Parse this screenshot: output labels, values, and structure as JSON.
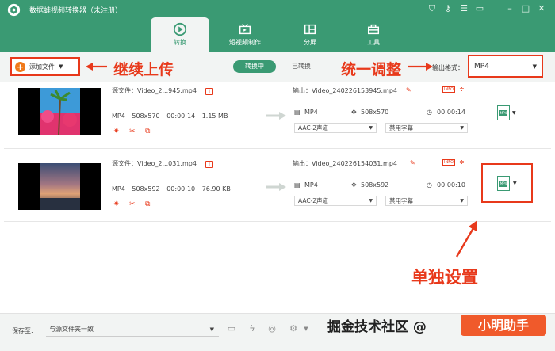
{
  "app": {
    "title": "数据蛙视频转换器（未注册）"
  },
  "tabs": [
    {
      "label": "转换",
      "active": true
    },
    {
      "label": "短视频制作",
      "active": false
    },
    {
      "label": "分屏",
      "active": false
    },
    {
      "label": "工具",
      "active": false
    }
  ],
  "toolbar": {
    "add_label": "添加文件",
    "seg_converting": "转换中",
    "seg_converted": "已转换",
    "format_label": "输出格式：",
    "format_value": "MP4"
  },
  "annotations": {
    "continue_upload": "继续上传",
    "unified_adjust": "统一调整",
    "single_setting": "单独设置"
  },
  "files": [
    {
      "source": "源文件：Video_2...945.mp4",
      "format": "MP4",
      "resolution": "508x570",
      "duration": "00:00:14",
      "size": "1.15 MB",
      "output": "输出：Video_240226153945.mp4",
      "out_format": "MP4",
      "out_resolution": "508x570",
      "out_duration": "00:00:14",
      "audio": "AAC-2声道",
      "subtitle": "禁用字幕"
    },
    {
      "source": "源文件：Video_2...031.mp4",
      "format": "MP4",
      "resolution": "508x592",
      "duration": "00:00:10",
      "size": "76.90 KB",
      "output": "输出：Video_240226154031.mp4",
      "out_format": "MP4",
      "out_resolution": "508x592",
      "out_duration": "00:00:10",
      "audio": "AAC-2声道",
      "subtitle": "禁用字幕"
    }
  ],
  "footer": {
    "save_label": "保存至:",
    "save_path": "与源文件夹一致"
  },
  "watermark": {
    "text": "掘金技术社区 @",
    "user": "小明助手"
  },
  "colors": {
    "brand": "#3a9a73",
    "annotation": "#e8391b"
  }
}
